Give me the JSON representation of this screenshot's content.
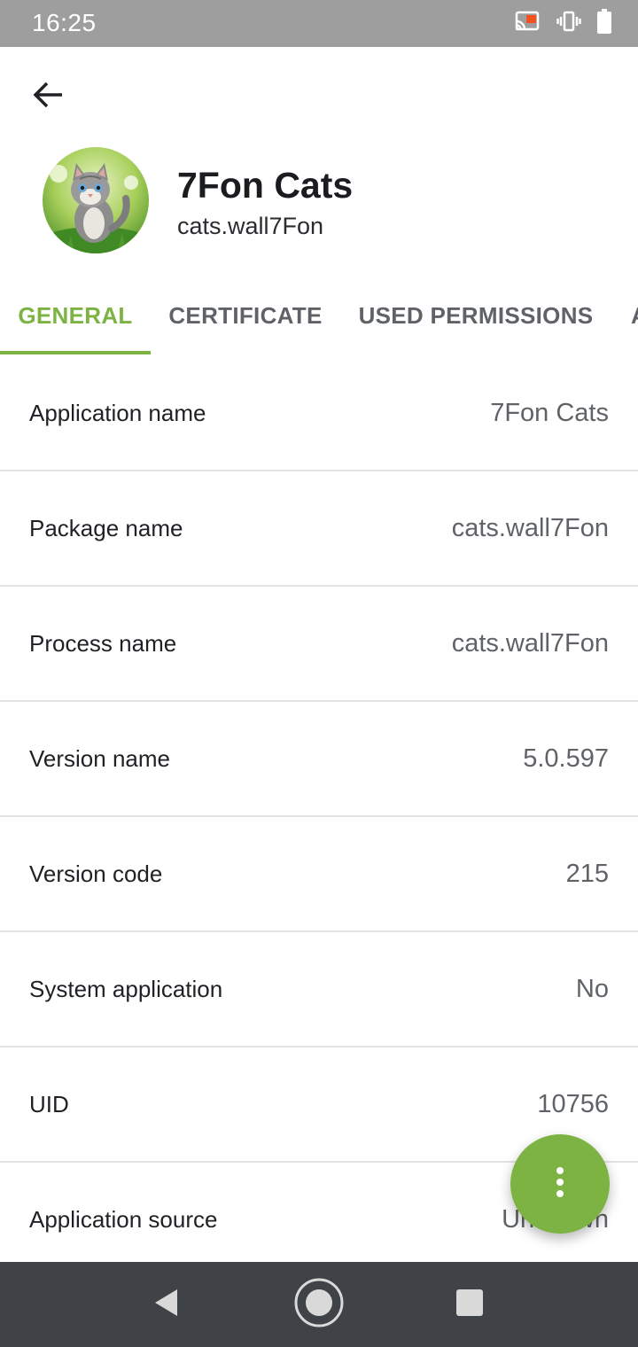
{
  "status_bar": {
    "time": "16:25",
    "icons": [
      "cast-icon",
      "vibrate-icon",
      "battery-icon"
    ]
  },
  "toolbar": {
    "back_icon": "arrow-back-icon"
  },
  "app": {
    "title": "7Fon Cats",
    "package": "cats.wall7Fon",
    "avatar_icon": "kitten-avatar-icon"
  },
  "tabs": [
    {
      "label": "GENERAL",
      "active": true
    },
    {
      "label": "CERTIFICATE",
      "active": false
    },
    {
      "label": "USED PERMISSIONS",
      "active": false
    },
    {
      "label": "A",
      "active": false
    }
  ],
  "info": {
    "rows": [
      {
        "label": "Application name",
        "value": "7Fon Cats"
      },
      {
        "label": "Package name",
        "value": "cats.wall7Fon"
      },
      {
        "label": "Process name",
        "value": "cats.wall7Fon"
      },
      {
        "label": "Version name",
        "value": "5.0.597"
      },
      {
        "label": "Version code",
        "value": "215"
      },
      {
        "label": "System application",
        "value": "No"
      },
      {
        "label": "UID",
        "value": "10756"
      },
      {
        "label": "Application source",
        "value": "Unknown"
      }
    ]
  },
  "fab": {
    "icon": "more-vert-icon"
  },
  "nav": {
    "icons": [
      "nav-back-icon",
      "nav-home-icon",
      "nav-recents-icon"
    ]
  },
  "colors": {
    "accent": "#7cb342",
    "status_bar": "#9e9e9e",
    "nav_bar": "#3f4347",
    "cast_highlight": "#f4511e"
  }
}
